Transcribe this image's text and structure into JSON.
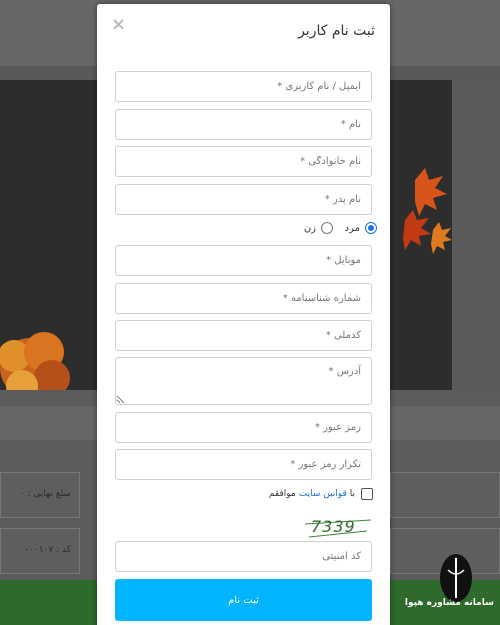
{
  "modal": {
    "title": "ثبت نام کاربر",
    "close_symbol": "×"
  },
  "form": {
    "username_placeholder": "ایمیل / نام کاربری *",
    "first_name_placeholder": "نام *",
    "last_name_placeholder": "نام خانوادگی *",
    "father_name_placeholder": "نام پدر *",
    "gender": {
      "male_label": "مرد",
      "female_label": "زن",
      "selected": "male"
    },
    "mobile_placeholder": "موبایل *",
    "id_number_placeholder": "شماره شناسنامه *",
    "national_code_placeholder": "کدملی *",
    "address_placeholder": "آدرس *",
    "password_placeholder": "رمز عبور *",
    "password_repeat_placeholder": "تکرار رمز عبور *",
    "terms": {
      "prefix": "با",
      "link": "قوانین سایت",
      "suffix": "موافقم"
    },
    "captcha_text": "7339",
    "security_code_placeholder": "کد امنیتی",
    "submit_label": "ثبت نام"
  },
  "background": {
    "card_left_top": "مبلغ نهایی : ۰",
    "card_left_bottom": "کد : ۰۰۰۱۰۷",
    "logo_text": "سامانه مشاوره هپوا"
  },
  "colors": {
    "accent": "#00b4ff",
    "link": "#1a6fcf",
    "captcha": "#2f6a2f"
  },
  "icons": {
    "close": "close-icon",
    "check": "check-icon",
    "logo": "quill-logo-icon"
  }
}
